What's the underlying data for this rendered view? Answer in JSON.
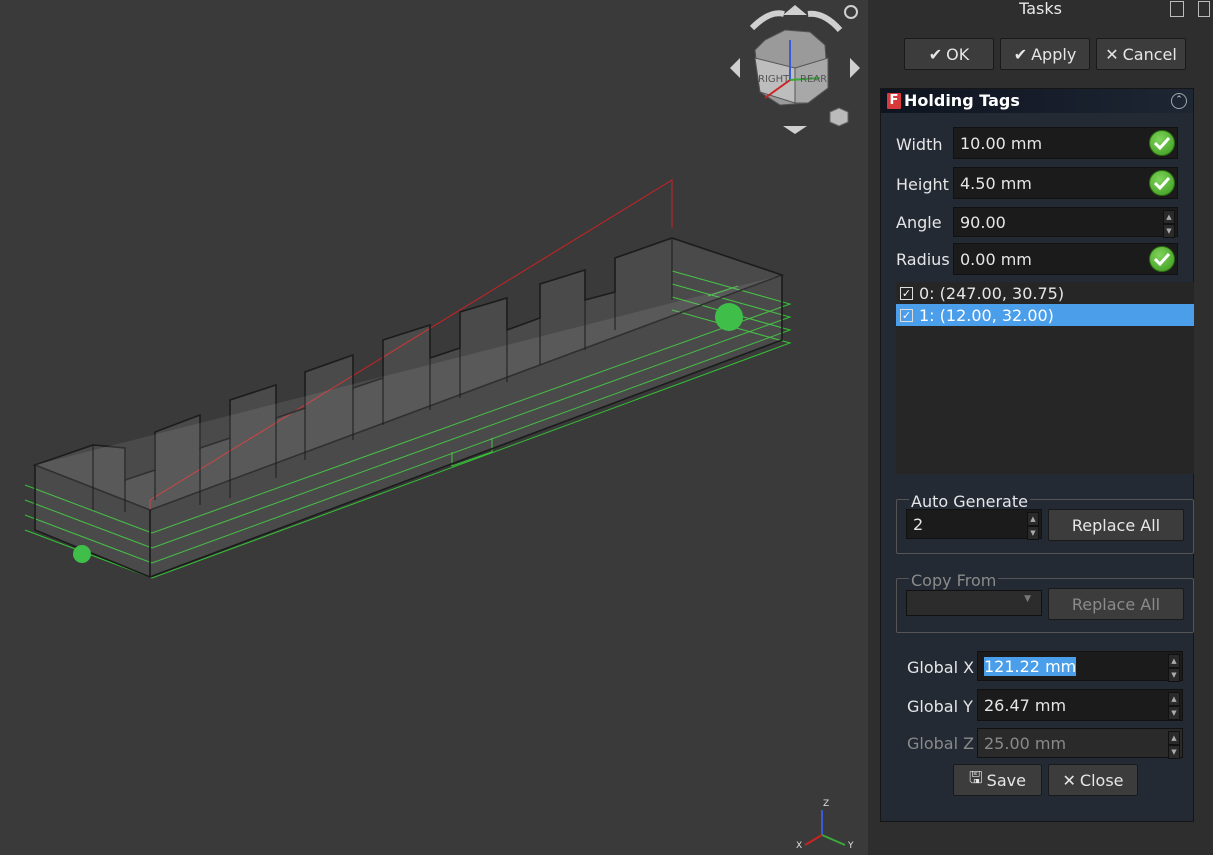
{
  "panel": {
    "title": "Tasks",
    "buttons": {
      "ok": "OK",
      "apply": "Apply",
      "cancel": "Cancel"
    }
  },
  "holding_tags": {
    "title": "Holding Tags",
    "width": {
      "label": "Width",
      "value": "10.00 mm"
    },
    "height": {
      "label": "Height",
      "value": "4.50 mm"
    },
    "angle": {
      "label": "Angle",
      "value": "90.00"
    },
    "radius": {
      "label": "Radius",
      "value": "0.00 mm"
    },
    "tags": [
      {
        "label": "0: (247.00, 30.75)",
        "checked": true,
        "selected": false
      },
      {
        "label": "1: (12.00, 32.00)",
        "checked": true,
        "selected": true
      }
    ],
    "auto_generate": {
      "label": "Auto Generate",
      "value": "2",
      "button": "Replace All"
    },
    "copy_from": {
      "label": "Copy From",
      "value": "",
      "button": "Replace All"
    },
    "global_x": {
      "label": "Global X",
      "value": "121.22 mm"
    },
    "global_y": {
      "label": "Global Y",
      "value": "26.47 mm"
    },
    "global_z": {
      "label": "Global Z",
      "value": "25.00 mm"
    },
    "save": "Save",
    "close": "Close"
  },
  "navcube": {
    "faces": [
      "RIGHT",
      "REAR"
    ]
  },
  "axes": {
    "x": "X",
    "y": "Y",
    "z": "Z"
  },
  "colors": {
    "selection": "#4a9eea",
    "path_green": "#3fd13f",
    "path_red": "#cc2222",
    "ok_green": "#4caf2b"
  }
}
